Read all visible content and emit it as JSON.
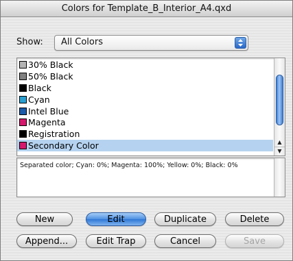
{
  "window": {
    "title": "Colors for Template_B_Interior_A4.qxd"
  },
  "show": {
    "label": "Show:",
    "value": "All Colors"
  },
  "colors": [
    {
      "name": "30% Black",
      "swatch": "#b3b3b3"
    },
    {
      "name": "50% Black",
      "swatch": "#808080"
    },
    {
      "name": "Black",
      "swatch": "#000000"
    },
    {
      "name": "Cyan",
      "swatch": "#2a9fd0"
    },
    {
      "name": "Intel Blue",
      "swatch": "#1a5aa8"
    },
    {
      "name": "Magenta",
      "swatch": "#d4186c"
    },
    {
      "name": "Registration",
      "swatch": "#000000"
    },
    {
      "name": "Secondary Color",
      "swatch": "#d4186c",
      "selected": true
    }
  ],
  "info": {
    "text": "Separated color; Cyan: 0%; Magenta: 100%; Yellow: 0%; Black: 0%"
  },
  "buttons": {
    "new": "New",
    "edit": "Edit",
    "duplicate": "Duplicate",
    "delete": "Delete",
    "append": "Append...",
    "edit_trap": "Edit Trap",
    "cancel": "Cancel",
    "save": "Save"
  }
}
